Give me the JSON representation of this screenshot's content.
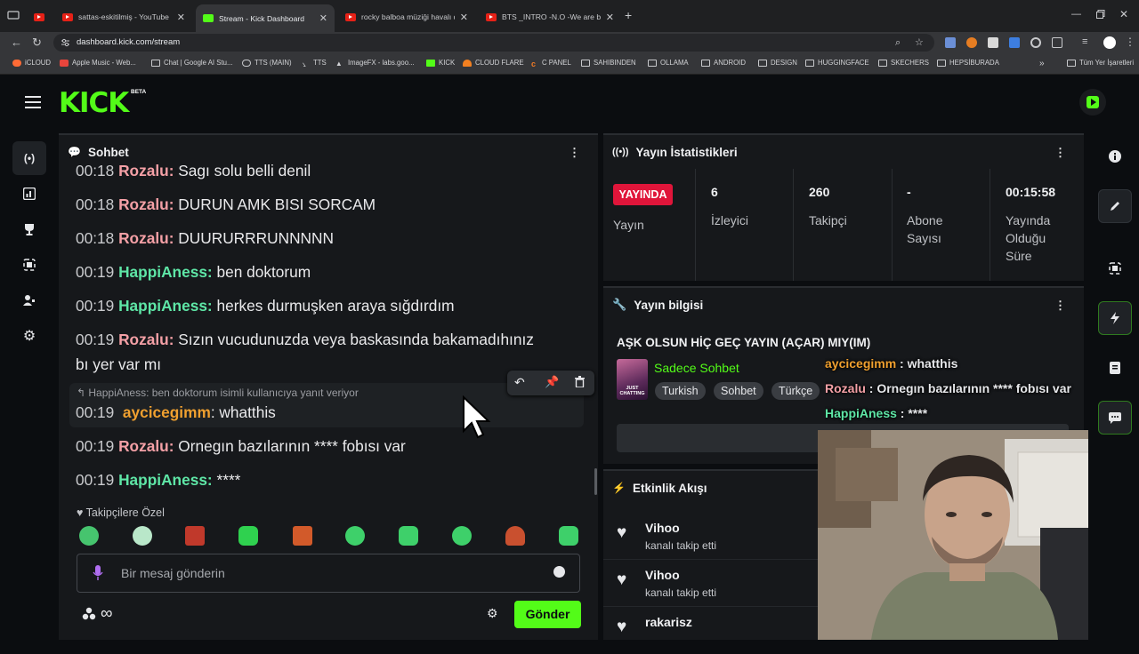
{
  "browser": {
    "tabs": [
      {
        "title": "sattas-eskitilmiş - YouTube",
        "kind": "youtube"
      },
      {
        "title": "Stream - Kick Dashboard",
        "kind": "kick",
        "active": true
      },
      {
        "title": "rocky balboa müziği havalı dövüş",
        "kind": "youtube"
      },
      {
        "title": "BTS _INTRO -N.O -We are bulletp",
        "kind": "youtube"
      }
    ],
    "url": "dashboard.kick.com/stream",
    "bookmarks": [
      "iCLOUD",
      "Apple Music - Web...",
      "Chat | Google AI Stu...",
      "TTS (MAIN)",
      "TTS",
      "ImageFX - labs.goo...",
      "KICK",
      "CLOUD FLARE",
      "C PANEL",
      "SAHIBINDEN",
      "OLLAMA",
      "ANDROID",
      "DESIGN",
      "HUGGINGFACE",
      "SKECHERS",
      "HEPSİBURADA"
    ],
    "bookmarks_overflow": "»",
    "other_bookmarks": "Tüm Yer İşaretleri"
  },
  "kick": {
    "logo": "KICK",
    "beta": "BETA"
  },
  "chat": {
    "title": "Sohbet",
    "messages": [
      {
        "time": "00:18",
        "user": "Rozalu:",
        "text": " Sagı solu belli denil",
        "color": "red"
      },
      {
        "time": "00:18",
        "user": "Rozalu:",
        "text": " DURUN AMK BISI SORCAM",
        "color": "red"
      },
      {
        "time": "00:18",
        "user": "Rozalu:",
        "text": " DUURURRRUNNNNN",
        "color": "red"
      },
      {
        "time": "00:19",
        "user": "HappiAness:",
        "text": " ben doktorum",
        "color": "green"
      },
      {
        "time": "00:19",
        "user": "HappiAness:",
        "text": " herkes durmuşken araya sığdırdım",
        "color": "green"
      },
      {
        "time": "00:19",
        "user": "Rozalu:",
        "text": " Sızın vucudunuzda veya baskasında bakamadıhınız",
        "color": "red",
        "cont": "bı yer var mı"
      },
      {
        "time": "00:19",
        "user": "Rozalu:",
        "text": " Ornegın bazılarının **** fobısı var",
        "color": "red"
      },
      {
        "time": "00:19",
        "user": "HappiAness:",
        "text": " ****",
        "color": "green"
      }
    ],
    "reply_note": "HappiAness: ben doktorum isimli kullanıcıya yanıt veriyor",
    "reply_message": {
      "time": "00:19",
      "user": "aycicegimm",
      "text": ": whatthis"
    },
    "followers_only": "Takipçilere Özel",
    "input_placeholder": "Bir mesaj gönderin",
    "send_label": "Gönder"
  },
  "stats": {
    "title": "Yayın İstatistikleri",
    "live_badge": "YAYINDA",
    "live_label": "Yayın",
    "items": [
      {
        "value": "6",
        "label_line1": "İzleyici",
        "label_line2": ""
      },
      {
        "value": "260",
        "label_line1": "Takipçi",
        "label_line2": ""
      },
      {
        "value": "-",
        "label_line1": "Abone",
        "label_line2": "Sayısı"
      },
      {
        "value": "00:15:58",
        "label_line1": "Yayında",
        "label_line2": "Olduğu",
        "label_line3": "Süre"
      }
    ]
  },
  "stream_info": {
    "title": "Yayın bilgisi",
    "stream_title": "AŞK OLSUN HİÇ GEÇ YAYIN (AÇAR) MIY(IM)",
    "category": "Sadece Sohbet",
    "thumb_text": "JUST CHATTING",
    "tags": [
      "Turkish",
      "Sohbet",
      "Türkçe"
    ],
    "overlay_chat": [
      {
        "user": "aycicegimm",
        "text": " : whatthis",
        "color": "orange"
      },
      {
        "user": "Rozalu",
        "text": " : Ornegın bazılarının **** fobısı var",
        "color": "red"
      },
      {
        "user": "HappiAness",
        "text": " : ****",
        "color": "green"
      }
    ]
  },
  "activity": {
    "title": "Etkinlik Akışı",
    "items": [
      {
        "name": "Vihoo",
        "sub": "kanalı takip etti"
      },
      {
        "name": "Vihoo",
        "sub": "kanalı takip etti"
      },
      {
        "name": "rakarisz",
        "sub": ""
      }
    ]
  },
  "colors": {
    "kick_green": "#53fc18",
    "live_red": "#e0153a",
    "send_green": "#53fc18"
  }
}
